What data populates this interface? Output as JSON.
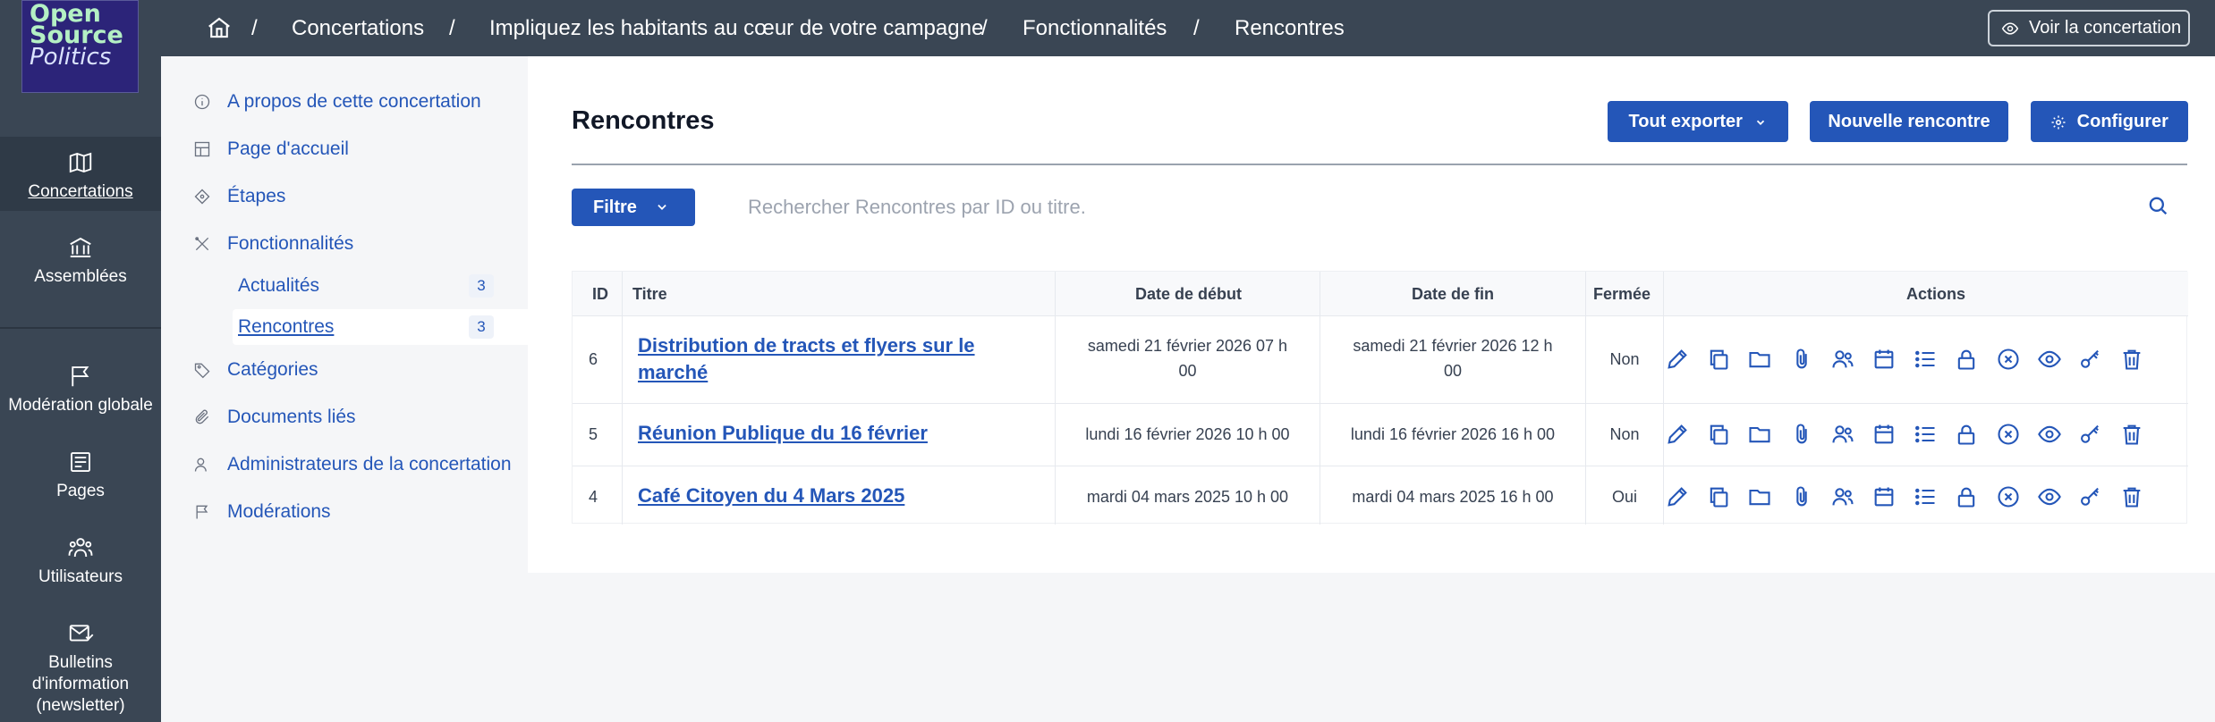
{
  "brand": {
    "line1": "Open",
    "line2": "Source",
    "line3": "Politics"
  },
  "rail": {
    "items": [
      {
        "label": "Concertations",
        "icon": "map-icon"
      },
      {
        "label": "Assemblées",
        "icon": "building-icon"
      },
      {
        "label": "Modération globale",
        "icon": "flag-icon"
      },
      {
        "label": "Pages",
        "icon": "pages-icon"
      },
      {
        "label": "Utilisateurs",
        "icon": "users-icon"
      },
      {
        "label": "Bulletins d'information (newsletter)",
        "icon": "newsletter-icon"
      }
    ]
  },
  "breadcrumb": {
    "items": [
      "Concertations",
      "Impliquez les habitants au cœur de votre campagne",
      "Fonctionnalités",
      "Rencontres"
    ],
    "separator": "/"
  },
  "view_button": "Voir la concertation",
  "subnav": {
    "items": [
      "A propos de cette concertation",
      "Page d'accueil",
      "Étapes",
      "Fonctionnalités",
      "Catégories",
      "Documents liés",
      "Administrateurs de la concertation",
      "Modérations"
    ],
    "subitems": [
      {
        "label": "Actualités",
        "count": "3"
      },
      {
        "label": "Rencontres",
        "count": "3"
      }
    ]
  },
  "main": {
    "title": "Rencontres",
    "buttons": {
      "export": "Tout exporter",
      "new": "Nouvelle rencontre",
      "configure": "Configurer"
    },
    "filter": "Filtre",
    "search_placeholder": "Rechercher Rencontres par ID ou titre."
  },
  "table": {
    "headers": {
      "id": "ID",
      "title": "Titre",
      "start": "Date de début",
      "end": "Date de fin",
      "closed": "Fermée",
      "actions": "Actions"
    },
    "rows": [
      {
        "id": "6",
        "title1": "Distribution de tracts et flyers sur le",
        "title2": "marché",
        "start1": "samedi 21 février 2026 07 h",
        "start2": "00",
        "end1": "samedi 21 février 2026 12 h",
        "end2": "00",
        "closed": "Non"
      },
      {
        "id": "5",
        "title": "Réunion Publique du 16 février",
        "start": "lundi 16 février 2026 10 h 00",
        "end": "lundi 16 février 2026 16 h 00",
        "closed": "Non"
      },
      {
        "id": "4",
        "title": "Café Citoyen du 4 Mars 2025",
        "start": "mardi 04 mars 2025 10 h 00",
        "end": "mardi 04 mars 2025 16 h 00",
        "closed": "Oui"
      }
    ],
    "action_icons": [
      "pencil-icon",
      "copy-icon",
      "folder-icon",
      "paperclip-icon",
      "registrations-icon",
      "calendar-icon",
      "list-icon",
      "lock-icon",
      "close-circle-icon",
      "eye-icon",
      "key-icon",
      "trash-icon"
    ]
  },
  "colors": {
    "accent": "#2456b8",
    "topbar": "#3a4654",
    "link": "#2456b8"
  }
}
